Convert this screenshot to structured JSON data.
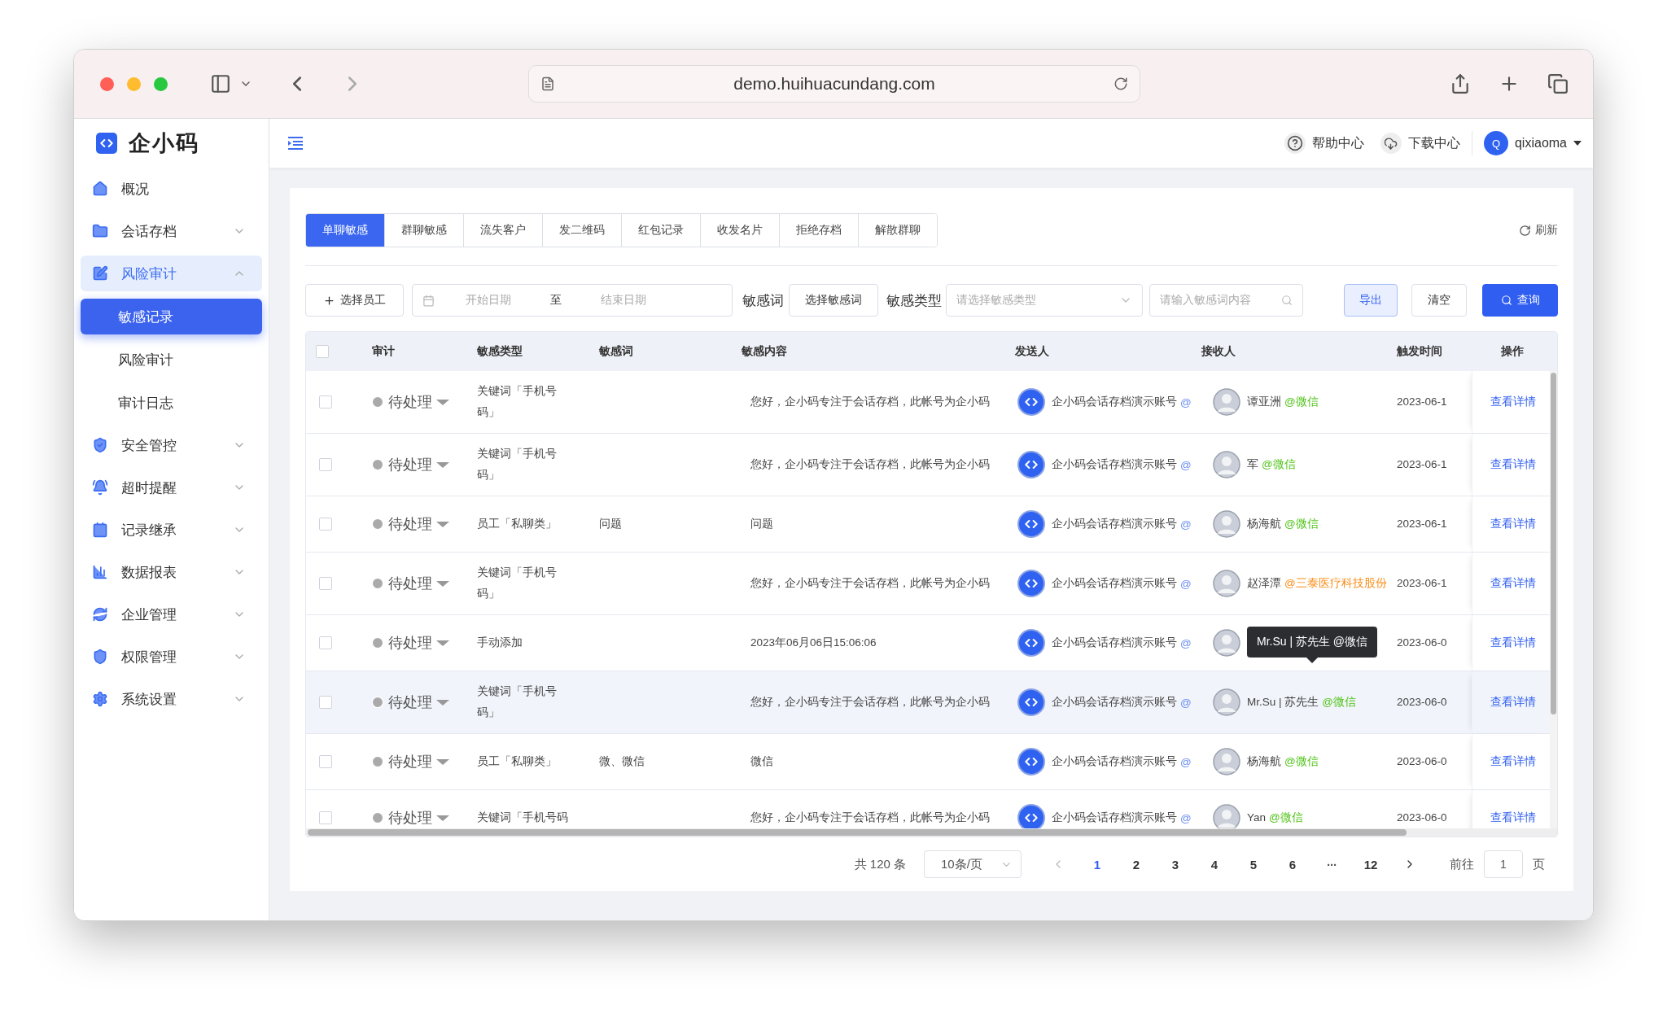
{
  "browser": {
    "url": "demo.huihuacundang.com"
  },
  "sidebar": {
    "logo": "企小码",
    "items": [
      {
        "label": "概况",
        "kind": "link",
        "selected": false
      },
      {
        "label": "会话存档",
        "kind": "group",
        "expanded": false,
        "selected": false
      },
      {
        "label": "风险审计",
        "kind": "group",
        "expanded": true,
        "selected": true,
        "children": [
          {
            "label": "敏感记录",
            "selected": true
          },
          {
            "label": "风险审计",
            "selected": false
          },
          {
            "label": "审计日志",
            "selected": false
          }
        ]
      },
      {
        "label": "安全管控",
        "kind": "group",
        "expanded": false,
        "selected": false
      },
      {
        "label": "超时提醒",
        "kind": "group",
        "expanded": false,
        "selected": false
      },
      {
        "label": "记录继承",
        "kind": "group",
        "expanded": false,
        "selected": false
      },
      {
        "label": "数据报表",
        "kind": "group",
        "expanded": false,
        "selected": false
      },
      {
        "label": "企业管理",
        "kind": "group",
        "expanded": false,
        "selected": false
      },
      {
        "label": "权限管理",
        "kind": "group",
        "expanded": false,
        "selected": false
      },
      {
        "label": "系统设置",
        "kind": "group",
        "expanded": false,
        "selected": false
      }
    ]
  },
  "header": {
    "links": [
      {
        "label": "帮助中心"
      },
      {
        "label": "下载中心"
      }
    ],
    "user": {
      "initial": "Q",
      "name": "qixiaoma"
    }
  },
  "tabs": [
    {
      "label": "单聊敏感",
      "selected": true
    },
    {
      "label": "群聊敏感",
      "selected": false
    },
    {
      "label": "流失客户",
      "selected": false
    },
    {
      "label": "发二维码",
      "selected": false
    },
    {
      "label": "红包记录",
      "selected": false
    },
    {
      "label": "收发名片",
      "selected": false
    },
    {
      "label": "拒绝存档",
      "selected": false
    },
    {
      "label": "解散群聊",
      "selected": false
    }
  ],
  "refresh": "刷新",
  "filters": {
    "employee_button": "选择员工",
    "date_start_placeholder": "开始日期",
    "date_separator": "至",
    "date_end_placeholder": "结束日期",
    "word_label": "敏感词",
    "word_button": "选择敏感词",
    "type_label": "敏感类型",
    "type_placeholder": "请选择敏感类型",
    "content_placeholder": "请输入敏感词内容",
    "export": "导出",
    "clear": "清空",
    "query": "查询"
  },
  "table": {
    "select_all_checked": false,
    "columns": [
      "审计",
      "敏感类型",
      "敏感词",
      "敏感内容",
      "发送人",
      "接收人",
      "触发时间",
      "操作"
    ],
    "rows": [
      {
        "checked": false,
        "highlighted": false,
        "status": "待处理",
        "type": "关键词「手机号码」",
        "content": "您好，企小码专注于会话存档，此帐号为企小码",
        "sender": {
          "name": "企小码会话存档演示账号",
          "tag": "@"
        },
        "receiver": {
          "name": "谭亚洲",
          "tag": "@微信",
          "color": "#52c41a"
        },
        "time": "2023-06-1",
        "action": "查看详情"
      },
      {
        "checked": false,
        "highlighted": false,
        "status": "待处理",
        "type": "关键词「手机号码」",
        "content": "您好，企小码专注于会话存档，此帐号为企小码",
        "sender": {
          "name": "企小码会话存档演示账号",
          "tag": "@"
        },
        "receiver": {
          "name": "军",
          "tag": "@微信",
          "color": "#52c41a"
        },
        "time": "2023-06-1",
        "action": "查看详情"
      },
      {
        "checked": false,
        "highlighted": false,
        "status": "待处理",
        "type": "员工「私聊类」",
        "word": "问题",
        "content": "问题",
        "sender": {
          "name": "企小码会话存档演示账号",
          "tag": "@"
        },
        "receiver": {
          "name": "杨海航",
          "tag": "@微信",
          "color": "#52c41a"
        },
        "time": "2023-06-1",
        "action": "查看详情"
      },
      {
        "checked": false,
        "highlighted": false,
        "status": "待处理",
        "type": "关键词「手机号码」",
        "content": "您好，企小码专注于会话存档，此帐号为企小码",
        "sender": {
          "name": "企小码会话存档演示账号",
          "tag": "@"
        },
        "receiver": {
          "name": "赵泽潭",
          "tag": "@三泰医疗科技股份",
          "color": "#fa8c16"
        },
        "time": "2023-06-1",
        "action": "查看详情"
      },
      {
        "checked": false,
        "highlighted": false,
        "status": "待处理",
        "type": "手动添加",
        "content": "2023年06月06日15:06:06",
        "sender": {
          "name": "企小码会话存档演示账号",
          "tag": "@"
        },
        "receiver": {
          "tooltip": "Mr.Su | 苏先生 @微信"
        },
        "time": "2023-06-0",
        "action": "查看详情"
      },
      {
        "checked": false,
        "highlighted": true,
        "status": "待处理",
        "type": "关键词「手机号码」",
        "content": "您好，企小码专注于会话存档，此帐号为企小码",
        "sender": {
          "name": "企小码会话存档演示账号",
          "tag": "@"
        },
        "receiver": {
          "name": "Mr.Su | 苏先生",
          "tag": "@微信",
          "color": "#52c41a"
        },
        "time": "2023-06-0",
        "action": "查看详情"
      },
      {
        "checked": false,
        "highlighted": false,
        "status": "待处理",
        "type": "员工「私聊类」",
        "word": "微、微信",
        "content": "微信",
        "sender": {
          "name": "企小码会话存档演示账号",
          "tag": "@"
        },
        "receiver": {
          "name": "杨海航",
          "tag": "@微信",
          "color": "#52c41a"
        },
        "time": "2023-06-0",
        "action": "查看详情"
      },
      {
        "checked": false,
        "highlighted": false,
        "status": "待处理",
        "type": "关键词「手机号码",
        "content": "您好，企小码专注于会话存档，此帐号为企小码",
        "sender": {
          "name": "企小码会话存档演示账号",
          "tag": "@"
        },
        "receiver": {
          "name": "Yan",
          "tag": "@微信",
          "color": "#52c41a"
        },
        "time": "2023-06-0",
        "action": "查看详情"
      }
    ]
  },
  "pagination": {
    "total": "共 120 条",
    "page_size": "10条/页",
    "pages": [
      {
        "label": "1",
        "kind": "page",
        "selected": true
      },
      {
        "label": "2",
        "kind": "page",
        "selected": false
      },
      {
        "label": "3",
        "kind": "page",
        "selected": false
      },
      {
        "label": "4",
        "kind": "page",
        "selected": false
      },
      {
        "label": "5",
        "kind": "page",
        "selected": false
      },
      {
        "label": "6",
        "kind": "page",
        "selected": false
      },
      {
        "label": "···",
        "kind": "more",
        "selected": false
      },
      {
        "label": "12",
        "kind": "page",
        "selected": false
      }
    ],
    "goto_label": "前往",
    "goto_value": "1",
    "goto_suffix": "页"
  }
}
